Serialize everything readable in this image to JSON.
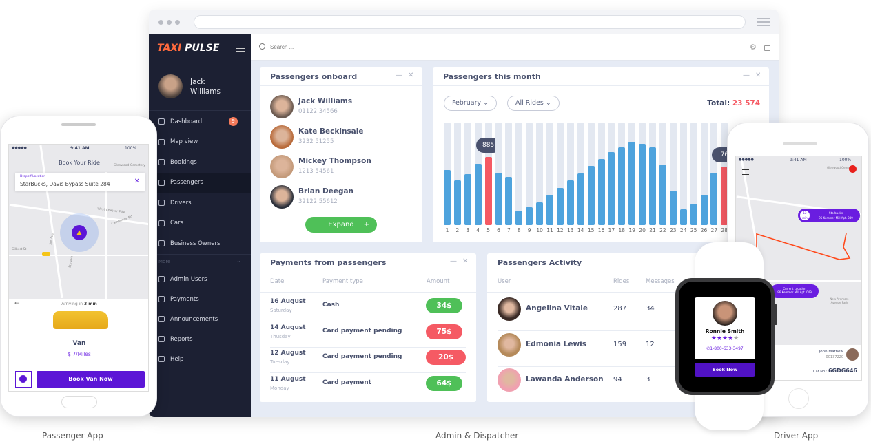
{
  "browser": {
    "menu_icon": "hamburger-icon"
  },
  "sidebar": {
    "logo_a": "TAXI",
    "logo_b": "PULSE",
    "user_first": "Jack",
    "user_last": "Williams",
    "items": [
      {
        "label": "Dashboard",
        "badge": "9"
      },
      {
        "label": "Map view"
      },
      {
        "label": "Bookings"
      },
      {
        "label": "Passengers",
        "active": true
      },
      {
        "label": "Drivers"
      },
      {
        "label": "Cars"
      },
      {
        "label": "Business Owners"
      }
    ],
    "more_label": "More",
    "more_items": [
      {
        "label": "Admin Users"
      },
      {
        "label": "Payments"
      },
      {
        "label": "Announcements"
      },
      {
        "label": "Reports"
      },
      {
        "label": "Help"
      }
    ]
  },
  "topbar": {
    "search_placeholder": "Search ..."
  },
  "onboard": {
    "title": "Passengers onboard",
    "expand": "Expand",
    "expand_icon": "+",
    "people": [
      {
        "name": "Jack Williams",
        "phone": "01122 34566"
      },
      {
        "name": "Kate Beckinsale",
        "phone": "3232 51255"
      },
      {
        "name": "Mickey Thompson",
        "phone": "1213 54561"
      },
      {
        "name": "Brian Deegan",
        "phone": "32122 55612"
      }
    ]
  },
  "month": {
    "title": "Passengers this month",
    "month_select": "February",
    "rides_select": "All Rides",
    "total_label": "Total:",
    "total_value": "23 574",
    "colors": {
      "bar": "#4ea3dd",
      "highlight": "#f55a64",
      "track": "#e3e8f1"
    }
  },
  "chart_data": {
    "type": "bar",
    "categories": [
      "1",
      "2",
      "3",
      "4",
      "5",
      "6",
      "7",
      "8",
      "9",
      "10",
      "11",
      "12",
      "13",
      "14",
      "15",
      "16",
      "17",
      "18",
      "19",
      "20",
      "21",
      "22",
      "23",
      "24",
      "25",
      "26",
      "27",
      "28"
    ],
    "values": [
      709,
      575,
      662,
      790,
      885,
      679,
      623,
      188,
      235,
      298,
      396,
      477,
      575,
      665,
      763,
      855,
      939,
      1010,
      1079,
      1049,
      1010,
      784,
      441,
      203,
      277,
      396,
      679,
      757
    ],
    "highlighted": [
      "5",
      "28"
    ],
    "labels": {
      "5": "885",
      "28": "76"
    },
    "ylim": [
      0,
      1326
    ]
  },
  "payments": {
    "title": "Payments from passengers",
    "headers": [
      "Date",
      "Payment type",
      "Amount"
    ],
    "rows": [
      {
        "date": "16 August",
        "day": "Saturday",
        "type": "Cash",
        "amount": "34$",
        "status": "green"
      },
      {
        "date": "14 August",
        "day": "Thusday",
        "type": "Card payment pending",
        "amount": "75$",
        "status": "red"
      },
      {
        "date": "12 August",
        "day": "Tuesday",
        "type": "Card payment pending",
        "amount": "20$",
        "status": "red"
      },
      {
        "date": "11 August",
        "day": "Monday",
        "type": "Card payment",
        "amount": "64$",
        "status": "green"
      }
    ]
  },
  "activity": {
    "title": "Passengers Activity",
    "headers": [
      "User",
      "Rides",
      "Messages"
    ],
    "rows": [
      {
        "name": "Angelina Vitale",
        "rides": "287",
        "messages": "34"
      },
      {
        "name": "Edmonia Lewis",
        "rides": "159",
        "messages": "12"
      },
      {
        "name": "Lawanda Anderson",
        "rides": "94",
        "messages": "3"
      }
    ]
  },
  "passenger_app": {
    "time": "9:41 AM",
    "battery": "100%",
    "title": "Book Your Ride",
    "dropoff_label": "Dropoff Location",
    "dropoff_value": "StarBucks, Davis Bypass Suite 284",
    "arriving_pre": "Arriving in",
    "arriving_val": "3 min",
    "car": "Van",
    "price": "$ 7/Miles",
    "book": "Book Van Now",
    "streets": [
      "West Chester Pike",
      "Gilbert St",
      "3rd Ave",
      "5th Ave",
      "Cambridge Rd",
      "Glenwood Cemetery"
    ]
  },
  "driver_app": {
    "time": "9:41 AM",
    "battery": "100%",
    "dest_eta": "12",
    "dest_eta_unit": "min",
    "dest_name": "Starbucks",
    "dest_addr": "95 Kemmer Mill Apt. 049",
    "cur_name": "Current Location",
    "cur_addr": "96 Kemmer Mill Apt. 049",
    "park": "New Ardmore Avenue Park",
    "driver_name": "John Mathew",
    "driver_id": "00137220",
    "car_label": "Car No :",
    "car_no": "6GDG646",
    "streets": [
      "Glenwood Cemetery"
    ]
  },
  "watch": {
    "name": "Ronnie Smith",
    "rating": 4,
    "stars": "★★★★",
    "star_off": "★",
    "phone": "1-800-633-3497",
    "book": "Book Now"
  },
  "captions": {
    "left": "Passenger App",
    "center": "Admin & Dispatcher",
    "right": "Driver App"
  }
}
